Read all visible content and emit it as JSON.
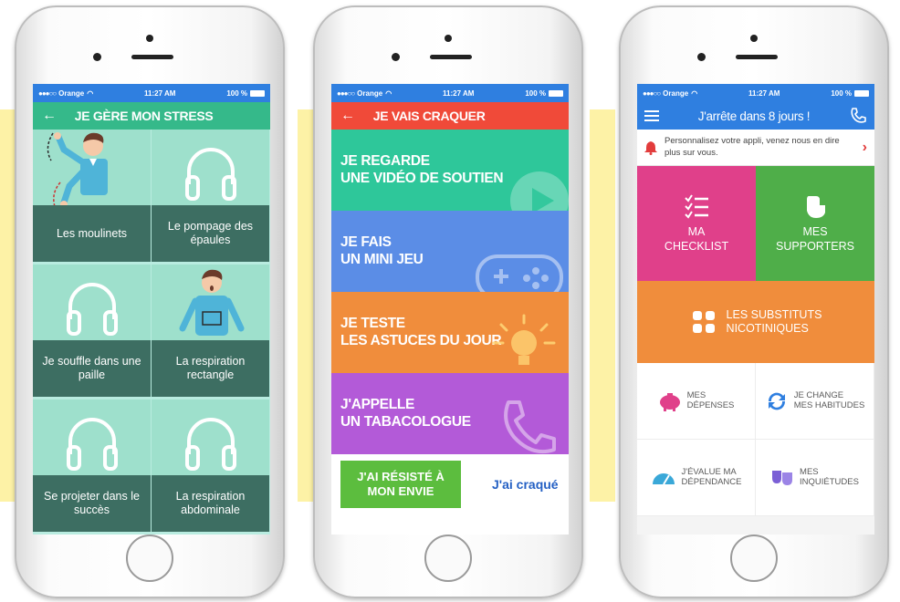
{
  "phone1": {
    "status": {
      "carrier": "Orange",
      "time": "11:27 AM",
      "battery": "100 %"
    },
    "title": "JE GÈRE MON STRESS",
    "items": [
      {
        "label": "Les moulinets"
      },
      {
        "label": "Le pompage des épaules"
      },
      {
        "label": "Je souffle dans une paille"
      },
      {
        "label": "La respiration rectangle"
      },
      {
        "label": "Se projeter dans le succès"
      },
      {
        "label": "La respiration abdominale"
      }
    ]
  },
  "phone2": {
    "status": {
      "carrier": "Orange",
      "time": "11:27 AM",
      "battery": "100 %"
    },
    "title": "JE VAIS CRAQUER",
    "tiles": [
      {
        "line1": "JE REGARDE",
        "line2": "UNE VIDÉO DE SOUTIEN",
        "color": "#2ec79a"
      },
      {
        "line1": "JE FAIS",
        "line2": "UN MINI JEU",
        "color": "#5b8de6"
      },
      {
        "line1": "JE TESTE",
        "line2": "LES ASTUCES DU JOUR",
        "color": "#f08d3c"
      },
      {
        "line1": "J'APPELLE",
        "line2": "UN TABACOLOGUE",
        "color": "#b35ad8"
      }
    ],
    "resist_line1": "J'AI RÉSISTÉ À",
    "resist_line2": "MON ENVIE",
    "craque_label": "J'ai craqué"
  },
  "phone3": {
    "status": {
      "carrier": "Orange",
      "time": "11:27 AM",
      "battery": "100 %"
    },
    "title": "J'arrête dans 8 jours !",
    "notification": "Personnalisez votre appli, venez nous en dire plus sur vous.",
    "checklist": {
      "line1": "MA",
      "line2": "CHECKLIST",
      "color": "#e0408a"
    },
    "supporters": {
      "line1": "MES",
      "line2": "SUPPORTERS",
      "color": "#4fae49"
    },
    "substituts": {
      "line1": "LES SUBSTITUTS",
      "line2": "NICOTINIQUES"
    },
    "depenses": {
      "line1": "MES",
      "line2": "DÉPENSES"
    },
    "habitudes": {
      "line1": "JE CHANGE",
      "line2": "MES HABITUDES"
    },
    "dependance": {
      "line1": "J'ÉVALUE MA",
      "line2": "DÉPENDANCE"
    },
    "inquietudes": {
      "line1": "MES",
      "line2": "INQUIÉTUDES"
    }
  },
  "colors": {
    "accent_green": "#35b98a",
    "accent_red": "#f04a39",
    "accent_blue": "#2f7fe0",
    "band_yellow": "#fdf2a6"
  }
}
